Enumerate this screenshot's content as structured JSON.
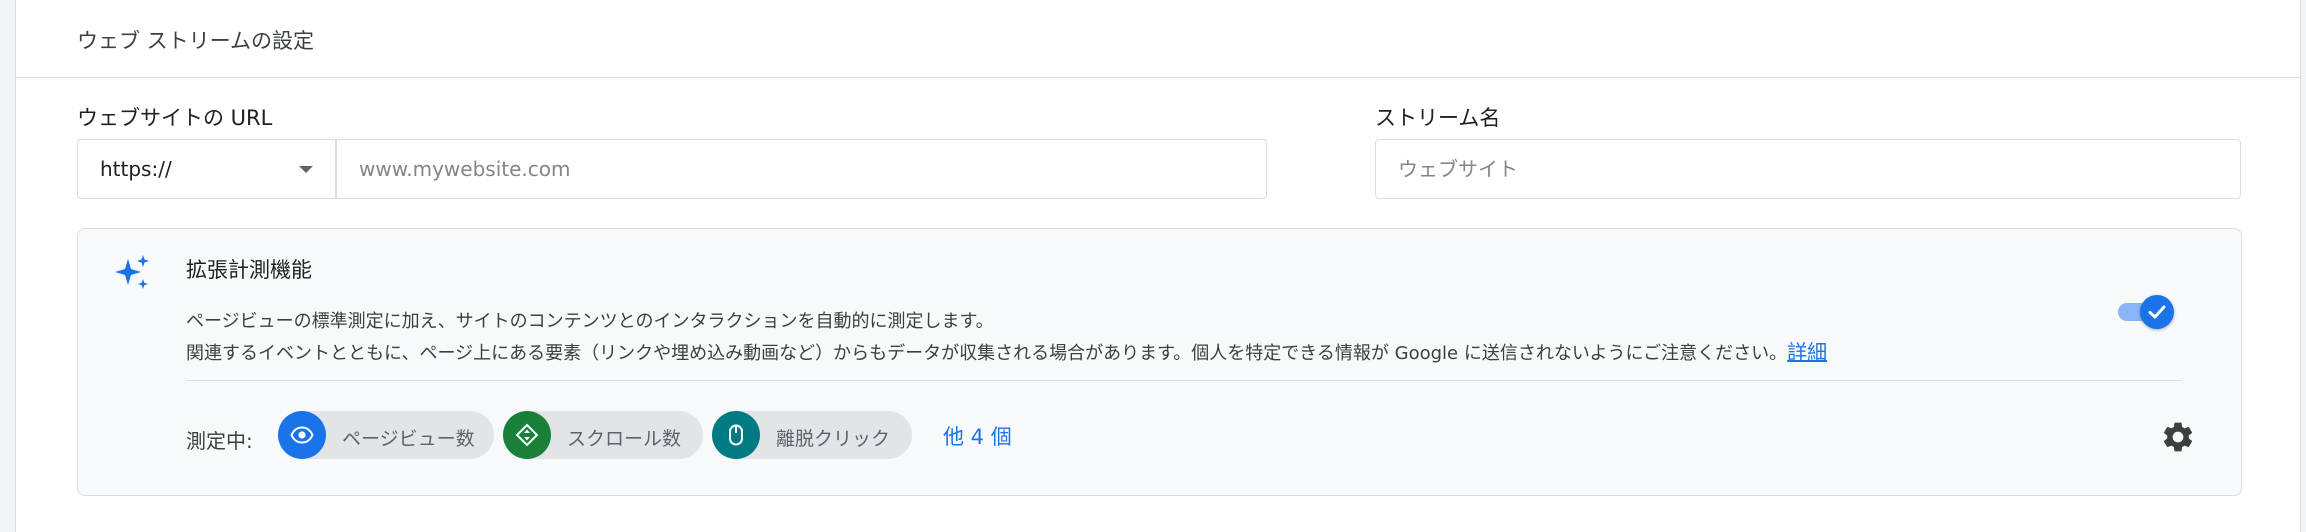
{
  "card": {
    "title": "ウェブ ストリームの設定"
  },
  "form": {
    "url_label": "ウェブサイトの URL",
    "protocol_selected": "https://",
    "url_placeholder": "www.mywebsite.com",
    "name_label": "ストリーム名",
    "name_placeholder": "ウェブサイト"
  },
  "enhanced_measurement": {
    "icon": "sparkle-icon",
    "title": "拡張計測機能",
    "description_line1": "ページビューの標準測定に加え、サイトのコンテンツとのインタラクションを自動的に測定します。",
    "description_line2": "関連するイベントとともに、ページ上にある要素（リンクや埋め込み動画など）からもデータが収集される場合があります。個人を特定できる情報が Google に送信されないようにご注意ください。",
    "learn_more": "詳細",
    "toggle_on": true,
    "measuring_label": "測定中:",
    "chips": [
      {
        "label": "ページビュー数",
        "icon": "eye-icon",
        "color": "#1a73e8"
      },
      {
        "label": "スクロール数",
        "icon": "scroll-icon",
        "color": "#188038"
      },
      {
        "label": "離脱クリック",
        "icon": "mouse-icon",
        "color": "#007b83"
      }
    ],
    "more": "他 4 個",
    "settings_icon": "gear-icon"
  },
  "colors": {
    "accent": "#1a73e8",
    "toggle_track": "#8ab4f8",
    "panel_bg": "#f8f9fa",
    "border": "#dadce0"
  }
}
